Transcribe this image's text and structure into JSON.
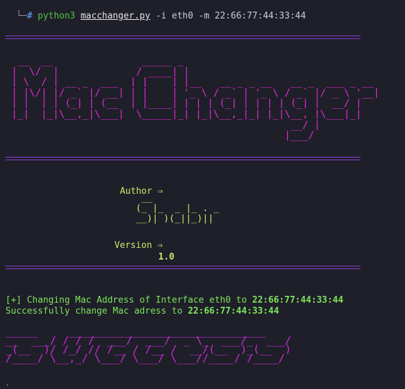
{
  "terminal": {
    "prompt_tree": "└─",
    "prompt_symbol": "#",
    "command_program": "python3",
    "command_file": "macchanger.py",
    "command_args": "-i eth0 -m 22:66:77:44:33:44"
  },
  "banner": {
    "ascii_art": "  __  __               _____ _                                    \n |  \\/  |             / ____| |                                   \n | \\  / | __ _  ___  | |    | |__   __ _ _ __   __ _  ___ _ __   \n | |\\/| |/ _` |/ __| | |    | '_ \\ / _` | '_ \\ / _` |/ _ \\ '__|  \n | |  | | (_| | (__  | |____| | | | (_| | | | | (_| |  __/ |     \n |_|  |_|\\__,_|\\___|  \\_____|_| |_|\\__,_|_| |_|\\__, |\\___|_|     \n                                                __/ |            \n                                               |___/             ",
    "accent_color": "#e32bd3"
  },
  "author": {
    "label": "Author ⇒",
    "ascii_art": " __\n(_ |_  _ |_ . _\n__)| )(_||_)||"
  },
  "version": {
    "label": "Version ⇒",
    "value": "1.0"
  },
  "output": {
    "line1_prefix": "[+] Changing Mac Address of Interface eth0 to ",
    "line1_mac": "22:66:77:44:33:44",
    "line2_prefix": "Successfully change Mac adress to ",
    "line2_mac": "22:66:77:44:33:44"
  },
  "success": {
    "ascii_art": "_____     _______________________________\n__  ___/ / / /  ___/  ___/  _ \\_  ___/_  ___/\n_(__  )/ /_/ // /__ / /__ /  __/(__  )_(__  )\n/____/ \\__,_/ \\___/ \\___/ \\___//____/ /____/"
  },
  "colors": {
    "background": "#1e1f29",
    "rule": "#8b3fd6",
    "author": "#cde86a",
    "output": "#7fe35d"
  }
}
